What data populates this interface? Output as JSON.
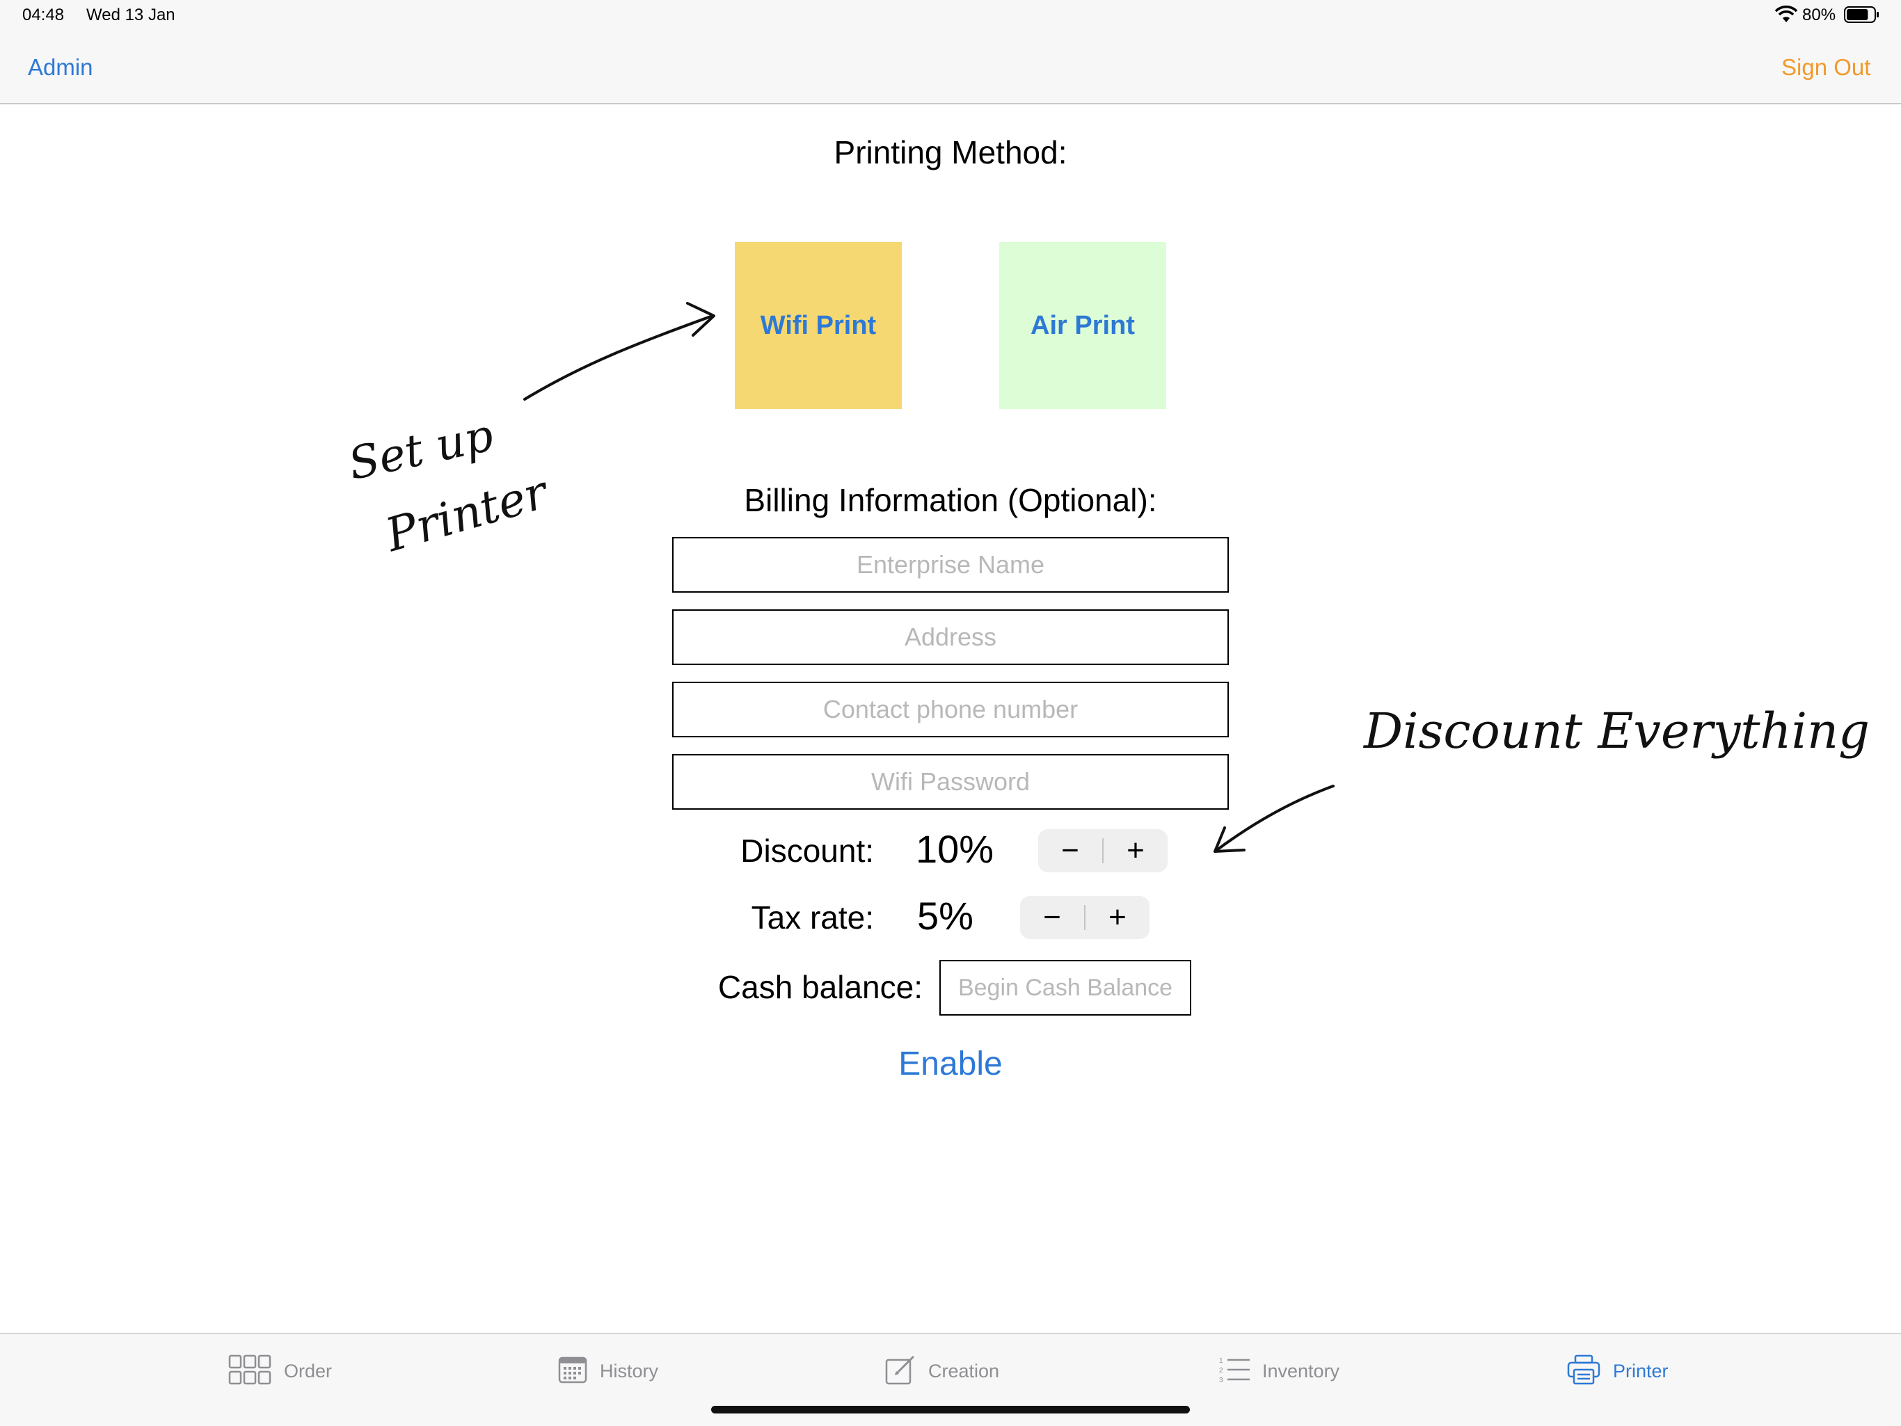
{
  "status_bar": {
    "time": "04:48",
    "date": "Wed 13 Jan",
    "battery": "80%",
    "battery_level": 0.8
  },
  "nav": {
    "left_label": "Admin",
    "right_label": "Sign Out",
    "left_color": "#2e79d6",
    "right_color": "#f09a2c"
  },
  "printing": {
    "title": "Printing Method:",
    "wifi_label": "Wifi Print",
    "air_label": "Air Print",
    "wifi_color": "#f5d872",
    "air_color": "#dcfdd6"
  },
  "billing": {
    "title": "Billing Information (Optional):",
    "enterprise_placeholder": "Enterprise Name",
    "address_placeholder": "Address",
    "phone_placeholder": "Contact phone number",
    "wifi_password_placeholder": "Wifi Password"
  },
  "discount": {
    "label": "Discount:",
    "value": "10%",
    "minus": "−",
    "plus": "+"
  },
  "tax": {
    "label": "Tax rate:",
    "value": "5%",
    "minus": "−",
    "plus": "+"
  },
  "cash": {
    "label": "Cash balance:",
    "placeholder": "Begin Cash Balance"
  },
  "enable_label": "Enable",
  "annotations": {
    "left_line1": "Set up",
    "left_line2": "Printer",
    "right": "Discount Everything"
  },
  "tabs": [
    {
      "label": "Order",
      "icon": "grid-icon",
      "active": false
    },
    {
      "label": "History",
      "icon": "calendar-icon",
      "active": false
    },
    {
      "label": "Creation",
      "icon": "compose-icon",
      "active": false
    },
    {
      "label": "Inventory",
      "icon": "list-icon",
      "active": false
    },
    {
      "label": "Printer",
      "icon": "printer-icon",
      "active": true
    }
  ],
  "colors": {
    "accent": "#2e79d6",
    "sign_out": "#f09a2c"
  }
}
